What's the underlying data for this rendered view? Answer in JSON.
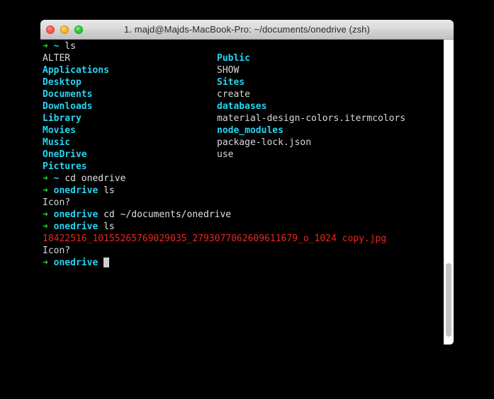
{
  "window": {
    "title": "1. majd@Majds-MacBook-Pro: ~/documents/onedrive (zsh)",
    "controls": {
      "close_label": "",
      "minimize_label": "",
      "zoom_label": ""
    }
  },
  "colors": {
    "background": "#000000",
    "directory": "#29d3ef",
    "file": "#d8d8d8",
    "error_red": "#e8281e",
    "prompt_arrow": "#1ee02e",
    "prompt_path": "#29d3ef",
    "cursor": "#d0d0d0",
    "titlebar": "#dcdcdc"
  },
  "terminal": {
    "prompt_arrow": "➜",
    "lines": [
      {
        "type": "prompt",
        "arrow": "➜",
        "path": "~",
        "command": "ls"
      },
      {
        "type": "listing",
        "col1": "ALTER",
        "col1_kind": "file",
        "col2": "Public",
        "col2_kind": "dir"
      },
      {
        "type": "listing",
        "col1": "Applications",
        "col1_kind": "dir",
        "col2": "SHOW",
        "col2_kind": "file"
      },
      {
        "type": "listing",
        "col1": "Desktop",
        "col1_kind": "dir",
        "col2": "Sites",
        "col2_kind": "dir"
      },
      {
        "type": "listing",
        "col1": "Documents",
        "col1_kind": "dir",
        "col2": "create",
        "col2_kind": "file"
      },
      {
        "type": "listing",
        "col1": "Downloads",
        "col1_kind": "dir",
        "col2": "databases",
        "col2_kind": "dir"
      },
      {
        "type": "listing",
        "col1": "Library",
        "col1_kind": "dir",
        "col2": "material-design-colors.itermcolors",
        "col2_kind": "file"
      },
      {
        "type": "listing",
        "col1": "Movies",
        "col1_kind": "dir",
        "col2": "node_modules",
        "col2_kind": "dir"
      },
      {
        "type": "listing",
        "col1": "Music",
        "col1_kind": "dir",
        "col2": "package-lock.json",
        "col2_kind": "file"
      },
      {
        "type": "listing",
        "col1": "OneDrive",
        "col1_kind": "dir",
        "col2": "use",
        "col2_kind": "file"
      },
      {
        "type": "listing",
        "col1": "Pictures",
        "col1_kind": "dir",
        "col2": "",
        "col2_kind": "file"
      },
      {
        "type": "prompt",
        "arrow": "➜",
        "path": "~",
        "command": "cd onedrive"
      },
      {
        "type": "prompt",
        "arrow": "➜",
        "path": "onedrive",
        "command": "ls"
      },
      {
        "type": "output",
        "text": "Icon?",
        "kind": "file"
      },
      {
        "type": "prompt",
        "arrow": "➜",
        "path": "onedrive",
        "command": "cd ~/documents/onedrive"
      },
      {
        "type": "prompt",
        "arrow": "➜",
        "path": "onedrive",
        "command": "ls"
      },
      {
        "type": "output",
        "text": "18422516_10155265769029035_2793077062609611679_o_1024 copy.jpg",
        "kind": "red"
      },
      {
        "type": "output",
        "text": "Icon?",
        "kind": "file"
      },
      {
        "type": "prompt",
        "arrow": "➜",
        "path": "onedrive",
        "command": "",
        "cursor": true
      }
    ]
  },
  "scrollbar": {
    "orientation": "vertical",
    "thumb_position": "bottom"
  }
}
